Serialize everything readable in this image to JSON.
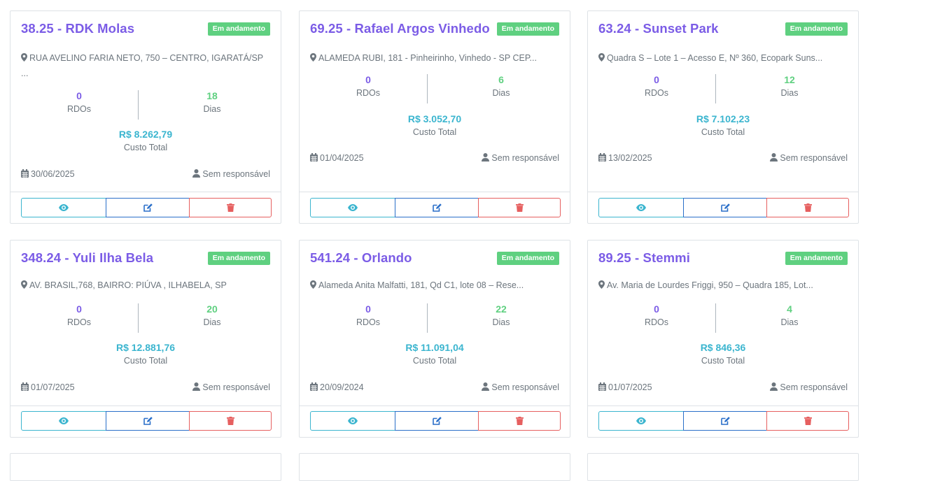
{
  "icons": {
    "location": "map-marker-icon",
    "calendar": "calendar-icon",
    "user": "user-icon",
    "view": "eye-icon",
    "edit": "edit-icon",
    "delete": "trash-icon"
  },
  "colors": {
    "title": "#7b5ce6",
    "badge": "#5fd080",
    "days": "#5fd080",
    "cost": "#3bb5cf",
    "view_button": "#3bb5cf",
    "edit_button": "#2a6fc9",
    "delete_button": "#e65f5f"
  },
  "labels": {
    "rdos": "RDOs",
    "days": "Dias",
    "cost": "Custo Total"
  },
  "cards": [
    {
      "title": "38.25 - RDK Molas",
      "status": "Em andamento",
      "address": "RUA AVELINO FARIA NETO, 750 – CENTRO, IGARATÁ/SP",
      "address_more": "...",
      "rdos": "0",
      "days": "18",
      "cost": "R$ 8.262,79",
      "date": "30/06/2025",
      "responsible": "Sem responsável"
    },
    {
      "title": "69.25 - Rafael Argos Vinhedo",
      "status": "Em andamento",
      "address": "ALAMEDA RUBI, 181 - Pinheirinho, Vinhedo - SP CEP...",
      "rdos": "0",
      "days": "6",
      "cost": "R$ 3.052,70",
      "date": "01/04/2025",
      "responsible": "Sem responsável"
    },
    {
      "title": "63.24 - Sunset Park",
      "status": "Em andamento",
      "address": "Quadra S – Lote 1 – Acesso E, Nº 360, Ecopark Suns...",
      "rdos": "0",
      "days": "12",
      "cost": "R$ 7.102,23",
      "date": "13/02/2025",
      "responsible": "Sem responsável"
    },
    {
      "title": "348.24 - Yuli Ilha Bela",
      "status": "Em andamento",
      "address": "AV. BRASIL,768, BAIRRO: PIÚVA , ILHABELA, SP",
      "rdos": "0",
      "days": "20",
      "cost": "R$ 12.881,76",
      "date": "01/07/2025",
      "responsible": "Sem responsável"
    },
    {
      "title": "541.24 - Orlando",
      "status": "Em andamento",
      "address": "Alameda Anita Malfatti, 181, Qd C1, lote 08 – Rese...",
      "rdos": "0",
      "days": "22",
      "cost": "R$ 11.091,04",
      "date": "20/09/2024",
      "responsible": "Sem responsável"
    },
    {
      "title": "89.25 - Stemmi",
      "status": "Em andamento",
      "address": "Av. Maria de Lourdes Friggi, 950 – Quadra 185, Lot...",
      "rdos": "0",
      "days": "4",
      "cost": "R$ 846,36",
      "date": "01/07/2025",
      "responsible": "Sem responsável"
    }
  ]
}
